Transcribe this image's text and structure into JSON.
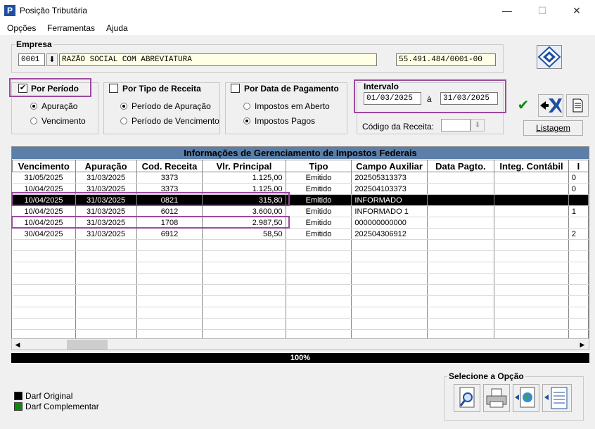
{
  "window": {
    "title": "Posição Tributária",
    "min": "—",
    "max": "☐",
    "close": "✕"
  },
  "menu": [
    "Opções",
    "Ferramentas",
    "Ajuda"
  ],
  "empresa": {
    "label": "Empresa",
    "code": "0001",
    "arrow": "⬇",
    "name": "RAZÃO SOCIAL COM ABREVIATURA",
    "cnpj": "55.491.484/0001-00"
  },
  "por_periodo": {
    "label": "Por Período",
    "checked": "✔",
    "options": [
      "Apuração",
      "Vencimento"
    ]
  },
  "por_tipo": {
    "label": "Por Tipo de Receita",
    "options": [
      "Período de Apuração",
      "Período de Vencimento"
    ]
  },
  "por_data": {
    "label": "Por Data de Pagamento",
    "options": [
      "Impostos em Aberto",
      "Impostos Pagos"
    ]
  },
  "intervalo": {
    "label": "Intervalo",
    "from": "01/03/2025",
    "sep": "à",
    "to": "31/03/2025"
  },
  "codigo_receita": {
    "label": "Código da Receita:"
  },
  "buttons": {
    "ok": "✔",
    "listagem": "Listagem"
  },
  "grid": {
    "title": "Informações de Gerenciamento de Impostos Federais",
    "columns": [
      "Vencimento",
      "Apuração",
      "Cod. Receita",
      "Vlr. Principal",
      "Tipo",
      "Campo Auxiliar",
      "Data Pagto.",
      "Integ. Contábil",
      "I"
    ],
    "rows": [
      [
        "31/05/2025",
        "31/03/2025",
        "3373",
        "1.125,00",
        "Emitido",
        "202505313373",
        "",
        "",
        "0"
      ],
      [
        "10/04/2025",
        "31/03/2025",
        "3373",
        "1.125,00",
        "Emitido",
        "202504103373",
        "",
        "",
        "0"
      ],
      [
        "10/04/2025",
        "31/03/2025",
        "0821",
        "315,80",
        "Emitido",
        "INFORMADO",
        "",
        "",
        ""
      ],
      [
        "10/04/2025",
        "31/03/2025",
        "6012",
        "3.600,00",
        "Emitido",
        "INFORMADO 1",
        "",
        "",
        "1"
      ],
      [
        "10/04/2025",
        "31/03/2025",
        "1708",
        "2.987,50",
        "Emitido",
        "000000000000",
        "",
        "",
        ""
      ],
      [
        "30/04/2025",
        "31/03/2025",
        "6912",
        "58,50",
        "Emitido",
        "202504306912",
        "",
        "",
        "2"
      ]
    ]
  },
  "progress": "100%",
  "selecione": {
    "label": "Selecione a Opção"
  },
  "legend": [
    {
      "label": "Darf Original",
      "color": "#000000"
    },
    {
      "label": "Darf Complementar",
      "color": "#0a8a0a"
    }
  ]
}
